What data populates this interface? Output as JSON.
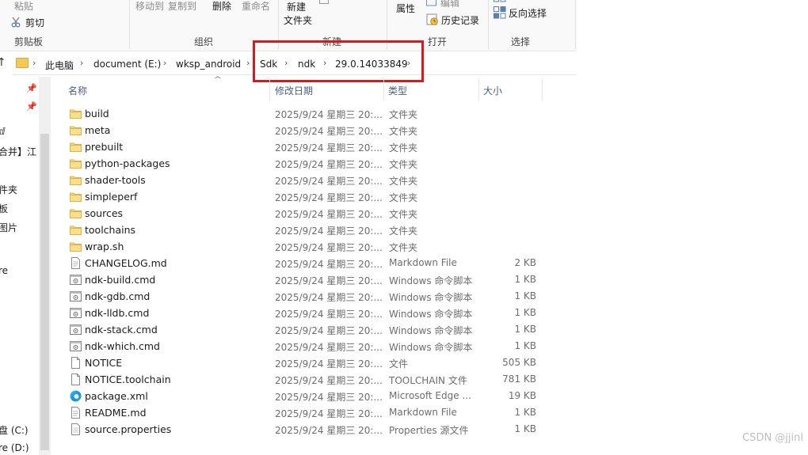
{
  "ribbon": {
    "clipboard": {
      "paste": "粘贴",
      "cut": "剪切",
      "group": "剪贴板"
    },
    "organize": {
      "move_to": "移动到",
      "copy_to": "复制到",
      "delete": "删除",
      "rename": "重命名",
      "group": "组织"
    },
    "new": {
      "new_folder_1": "新建",
      "new_folder_2": "文件夹",
      "group": "新建"
    },
    "open": {
      "properties": "属性",
      "edit": "编辑",
      "history": "历史记录",
      "group": "打开"
    },
    "select": {
      "invert": "反向选择",
      "group": "选择"
    }
  },
  "address": {
    "crumbs": [
      "此电脑",
      "document (E:)",
      "wksp_android",
      "Sdk",
      "ndk",
      "29.0.14033849"
    ]
  },
  "nav": {
    "items": [
      "ⅆ",
      "合并】江",
      "件夹",
      "板",
      "图片",
      "re",
      "盘 (C:)",
      "re (D:)"
    ]
  },
  "columns": {
    "name": "名称",
    "date": "修改日期",
    "type": "类型",
    "size": "大小"
  },
  "files": [
    {
      "name": "build",
      "date": "2025/9/24 星期三 20:...",
      "type": "文件夹",
      "size": "",
      "icon": "folder-icon"
    },
    {
      "name": "meta",
      "date": "2025/9/24 星期三 20:...",
      "type": "文件夹",
      "size": "",
      "icon": "folder-icon"
    },
    {
      "name": "prebuilt",
      "date": "2025/9/24 星期三 20:...",
      "type": "文件夹",
      "size": "",
      "icon": "folder-icon"
    },
    {
      "name": "python-packages",
      "date": "2025/9/24 星期三 20:...",
      "type": "文件夹",
      "size": "",
      "icon": "folder-icon"
    },
    {
      "name": "shader-tools",
      "date": "2025/9/24 星期三 20:...",
      "type": "文件夹",
      "size": "",
      "icon": "folder-icon"
    },
    {
      "name": "simpleperf",
      "date": "2025/9/24 星期三 20:...",
      "type": "文件夹",
      "size": "",
      "icon": "folder-icon"
    },
    {
      "name": "sources",
      "date": "2025/9/24 星期三 20:...",
      "type": "文件夹",
      "size": "",
      "icon": "folder-icon"
    },
    {
      "name": "toolchains",
      "date": "2025/9/24 星期三 20:...",
      "type": "文件夹",
      "size": "",
      "icon": "folder-icon"
    },
    {
      "name": "wrap.sh",
      "date": "2025/9/24 星期三 20:...",
      "type": "文件夹",
      "size": "",
      "icon": "folder-icon"
    },
    {
      "name": "CHANGELOG.md",
      "date": "2025/9/24 星期三 20:...",
      "type": "Markdown File",
      "size": "2 KB",
      "icon": "markdown-file-icon"
    },
    {
      "name": "ndk-build.cmd",
      "date": "2025/9/24 星期三 20:...",
      "type": "Windows 命令脚本",
      "size": "1 KB",
      "icon": "cmd-script-icon"
    },
    {
      "name": "ndk-gdb.cmd",
      "date": "2025/9/24 星期三 20:...",
      "type": "Windows 命令脚本",
      "size": "1 KB",
      "icon": "cmd-script-icon"
    },
    {
      "name": "ndk-lldb.cmd",
      "date": "2025/9/24 星期三 20:...",
      "type": "Windows 命令脚本",
      "size": "1 KB",
      "icon": "cmd-script-icon"
    },
    {
      "name": "ndk-stack.cmd",
      "date": "2025/9/24 星期三 20:...",
      "type": "Windows 命令脚本",
      "size": "1 KB",
      "icon": "cmd-script-icon"
    },
    {
      "name": "ndk-which.cmd",
      "date": "2025/9/24 星期三 20:...",
      "type": "Windows 命令脚本",
      "size": "1 KB",
      "icon": "cmd-script-icon"
    },
    {
      "name": "NOTICE",
      "date": "2025/9/24 星期三 20:...",
      "type": "文件",
      "size": "505 KB",
      "icon": "file-icon"
    },
    {
      "name": "NOTICE.toolchain",
      "date": "2025/9/24 星期三 20:...",
      "type": "TOOLCHAIN 文件",
      "size": "781 KB",
      "icon": "file-icon"
    },
    {
      "name": "package.xml",
      "date": "2025/9/24 星期三 20:...",
      "type": "Microsoft Edge ...",
      "size": "19 KB",
      "icon": "edge-xml-icon"
    },
    {
      "name": "README.md",
      "date": "2025/9/24 星期三 20:...",
      "type": "Markdown File",
      "size": "1 KB",
      "icon": "markdown-file-icon"
    },
    {
      "name": "source.properties",
      "date": "2025/9/24 星期三 20:...",
      "type": "Properties 源文件",
      "size": "1 KB",
      "icon": "properties-file-icon"
    }
  ],
  "watermark": "CSDN @jjinl"
}
